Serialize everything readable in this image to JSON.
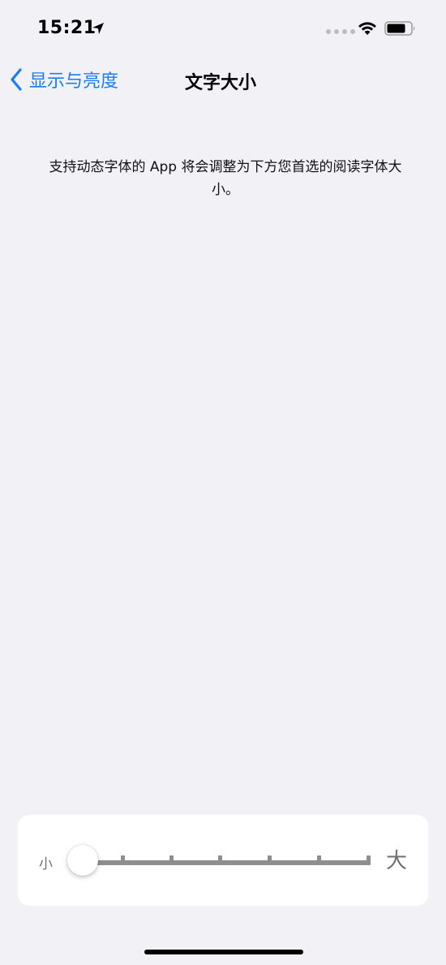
{
  "status_bar": {
    "time": "15:21",
    "location_icon": "location-arrow-icon",
    "signal_icon": "cellular-dots-icon",
    "wifi_icon": "wifi-icon",
    "battery_icon": "battery-icon"
  },
  "nav": {
    "back_label": "显示与亮度",
    "title": "文字大小"
  },
  "description": "支持动态字体的 App 将会调整为下方您首选的阅读字体大小。",
  "slider": {
    "min_label": "小",
    "max_label": "大",
    "steps": 7,
    "selected_step": 1
  },
  "colors": {
    "accent": "#1a7cf5",
    "background": "#f2f1f6",
    "card": "#ffffff",
    "track": "#8e8e8e"
  }
}
